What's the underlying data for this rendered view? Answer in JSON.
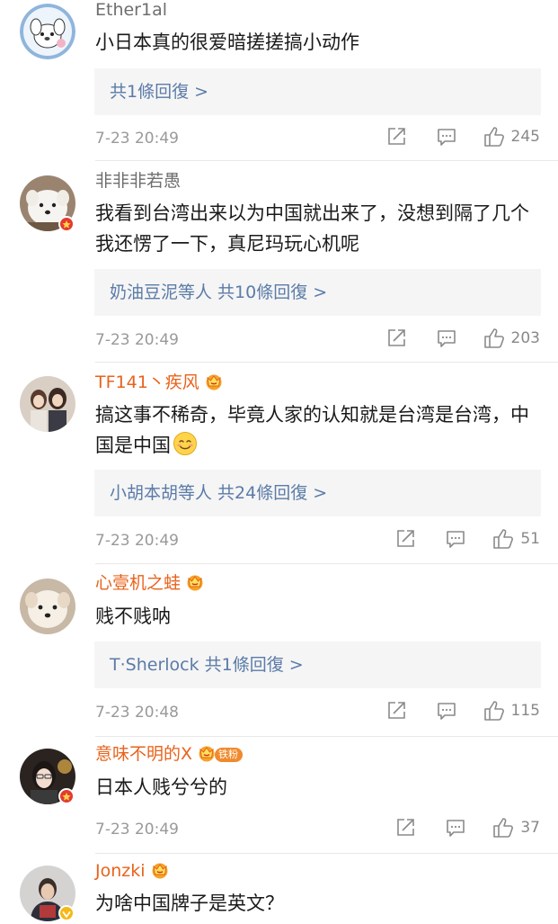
{
  "comments": [
    {
      "name": "Ether1al",
      "text": "小日本真的很爱暗搓搓搞小动作",
      "reply_summary": "共1條回復 >",
      "time": "7-23 20:49",
      "likes": "245"
    },
    {
      "name": "非非非若愚",
      "text": "我看到台湾出来以为中国就出来了，没想到隔了几个我还愣了一下，真尼玛玩心机呢",
      "reply_summary": "奶油豆泥等人 共10條回復 >",
      "time": "7-23 20:49",
      "likes": "203"
    },
    {
      "name": "TF141丶疾风",
      "text": "搞这事不稀奇，毕竟人家的认知就是台湾是台湾，中国是中国",
      "reply_summary": "小胡本胡等人 共24條回復 >",
      "time": "7-23 20:49",
      "likes": "51"
    },
    {
      "name": "心壹机之蛙",
      "text": "贱不贱呐",
      "reply_summary": "T·Sherlock 共1條回復 >",
      "time": "7-23 20:48",
      "likes": "115"
    },
    {
      "name": "意味不明的X",
      "fan_badge": "铁粉",
      "text": "日本人贱兮兮的",
      "time": "7-23 20:49",
      "likes": "37"
    },
    {
      "name": "Jonzki",
      "text": "为啥中国牌子是英文？"
    }
  ],
  "colors": {
    "name_gray": "#6e6e6e",
    "name_orange": "#e8631c",
    "reply_link": "#5b7ba8",
    "reply_bg": "#f5f5f5",
    "meta_gray": "#999999"
  },
  "icons": [
    "share-icon",
    "comment-icon",
    "like-icon",
    "crown-badge-icon",
    "red-star-badge-icon",
    "verified-badge-icon",
    "smile-emoji-icon"
  ]
}
